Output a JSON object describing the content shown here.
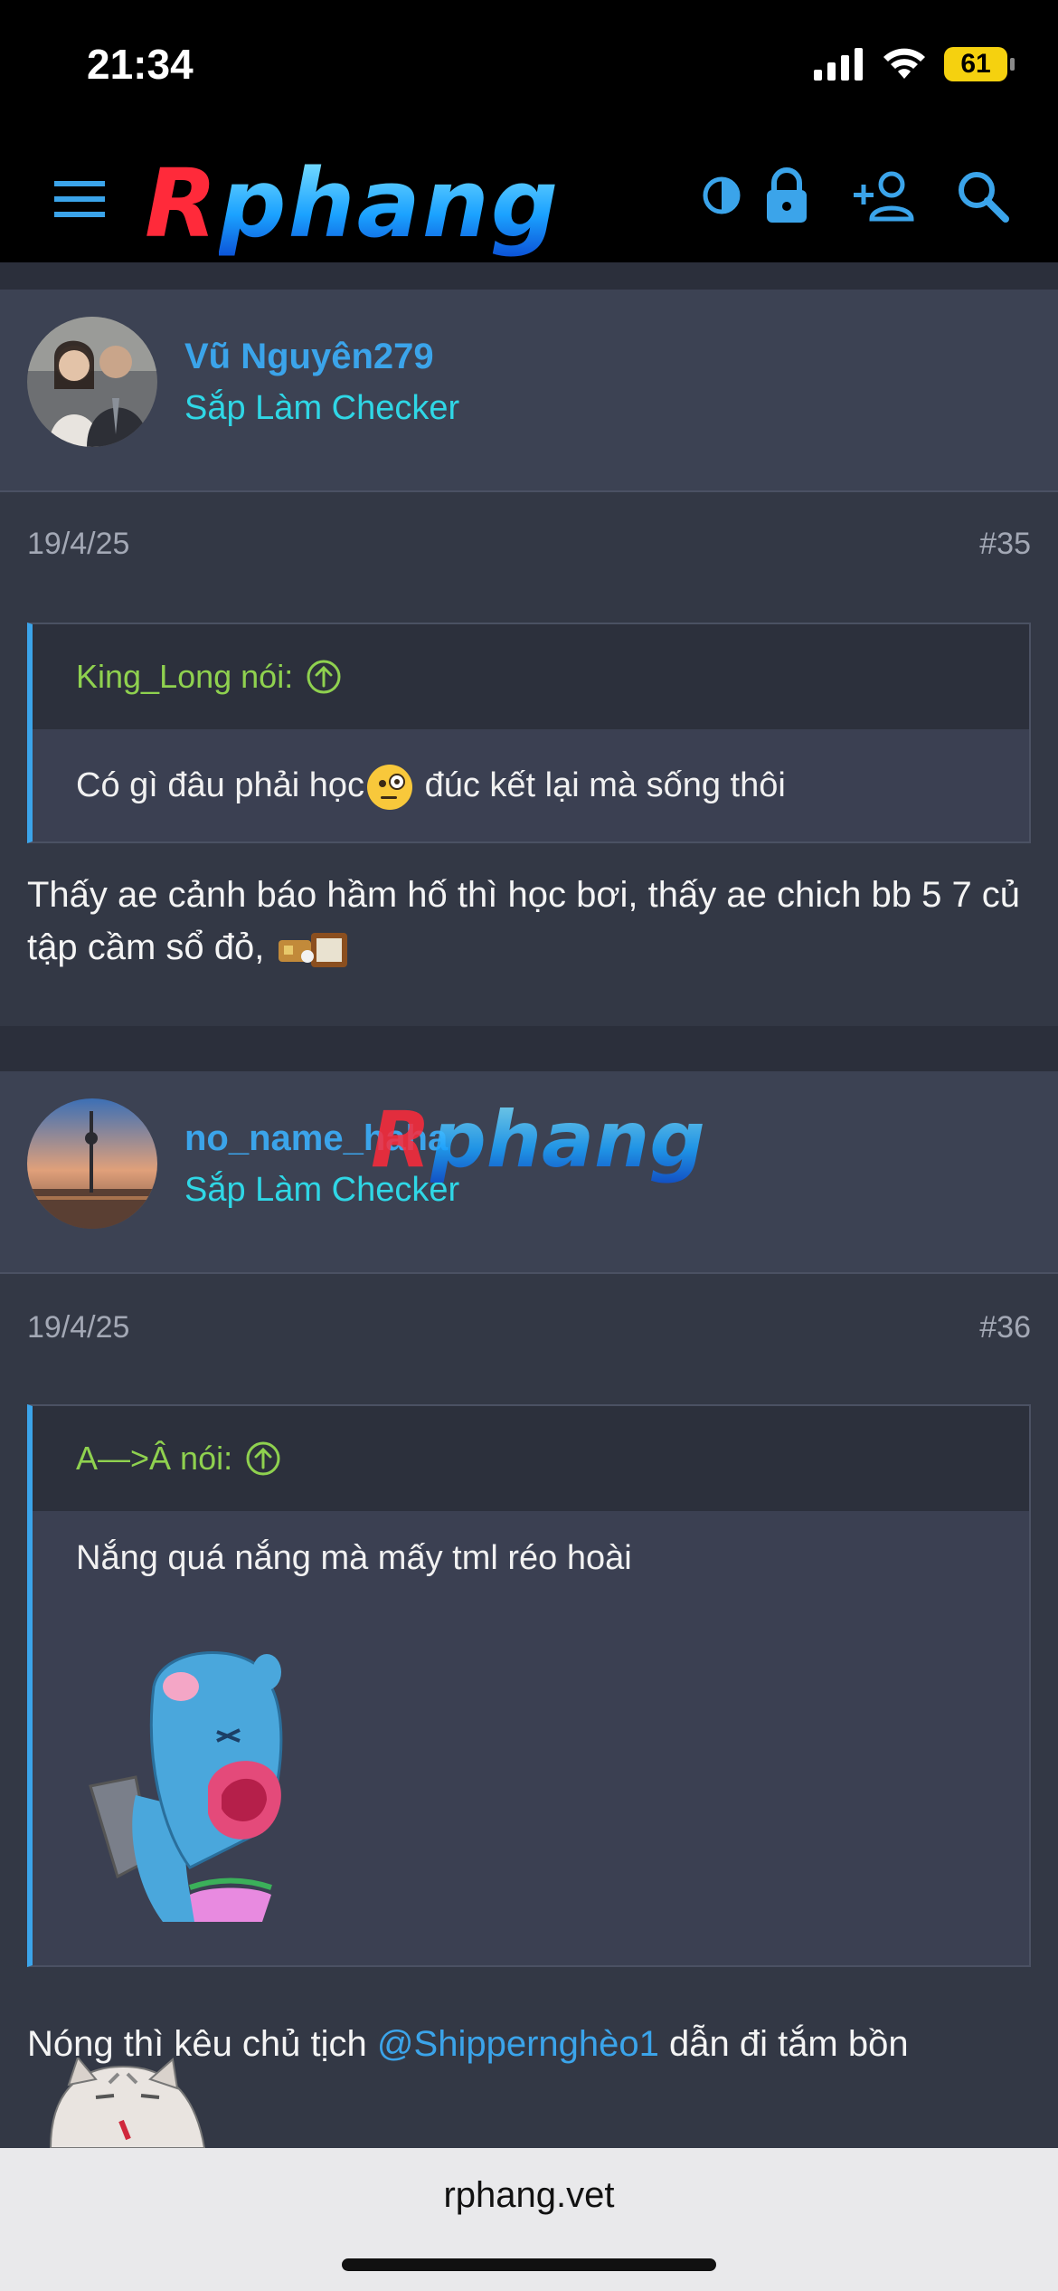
{
  "status": {
    "time": "21:34",
    "battery": "61"
  },
  "header": {
    "logo_first": "R",
    "logo_rest": "phang"
  },
  "posts": [
    {
      "username": "Vũ Nguyên279",
      "user_title": "Sắp Làm Checker",
      "date": "19/4/25",
      "number": "#35",
      "quote_author": "King_Long nói:",
      "quote_text_a": "Có gì đâu phải học",
      "quote_text_b": " đúc kết lại mà sống thôi",
      "text": "Thấy ae cảnh báo hầm hố thì học bơi, thấy ae chich bb 5 7 củ tập cầm sổ đỏ,"
    },
    {
      "username": "no_name_haha",
      "user_title": "Sắp Làm Checker",
      "date": "19/4/25",
      "number": "#36",
      "quote_author": "A—>Â nói:",
      "quote_text": "Nắng quá nắng mà mấy tml réo hoài",
      "text_before": "Nóng thì kêu chủ tịch ",
      "mention": "@Shippernghèo1",
      "text_after": " dẫn đi tắm bồn"
    }
  ],
  "watermark": {
    "first": "R",
    "rest": "phang"
  },
  "browser": {
    "url": "rphang.vet"
  },
  "colors": {
    "accent": "#3ba4ea",
    "title": "#2fd7e6",
    "quote_author": "#8fd14f",
    "background": "#333845"
  }
}
